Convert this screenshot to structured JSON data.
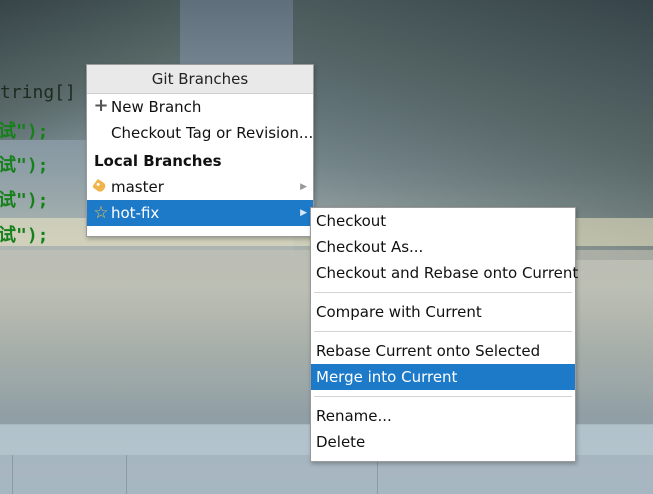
{
  "editor": {
    "code_lines": [
      {
        "text": "tring[]"
      },
      {
        "text": "试\");",
        "highlight": false
      },
      {
        "text": "试\");",
        "highlight": false
      },
      {
        "text": "试\");",
        "highlight": false
      },
      {
        "text": "试\");",
        "highlight": true
      }
    ],
    "colors": {
      "string": "#16801a",
      "current_line": "#eee8c4"
    }
  },
  "popup": {
    "title": "Git Branches",
    "actions": [
      {
        "label": "New Branch",
        "icon": "plus-icon"
      },
      {
        "label": "Checkout Tag or Revision...",
        "icon": ""
      }
    ],
    "local_section_label": "Local Branches",
    "branches": [
      {
        "label": "master",
        "icon": "tag-icon",
        "selected": false
      },
      {
        "label": "hot-fix",
        "icon": "star-icon",
        "selected": true
      }
    ],
    "selection_color": "#1d7ac9"
  },
  "submenu": {
    "groups": [
      [
        "Checkout",
        "Checkout As...",
        "Checkout and Rebase onto Current"
      ],
      [
        "Compare with Current"
      ],
      [
        "Rebase Current onto Selected",
        "Merge into Current"
      ],
      [
        "Rename...",
        "Delete"
      ]
    ],
    "selected_label": "Merge into Current"
  }
}
